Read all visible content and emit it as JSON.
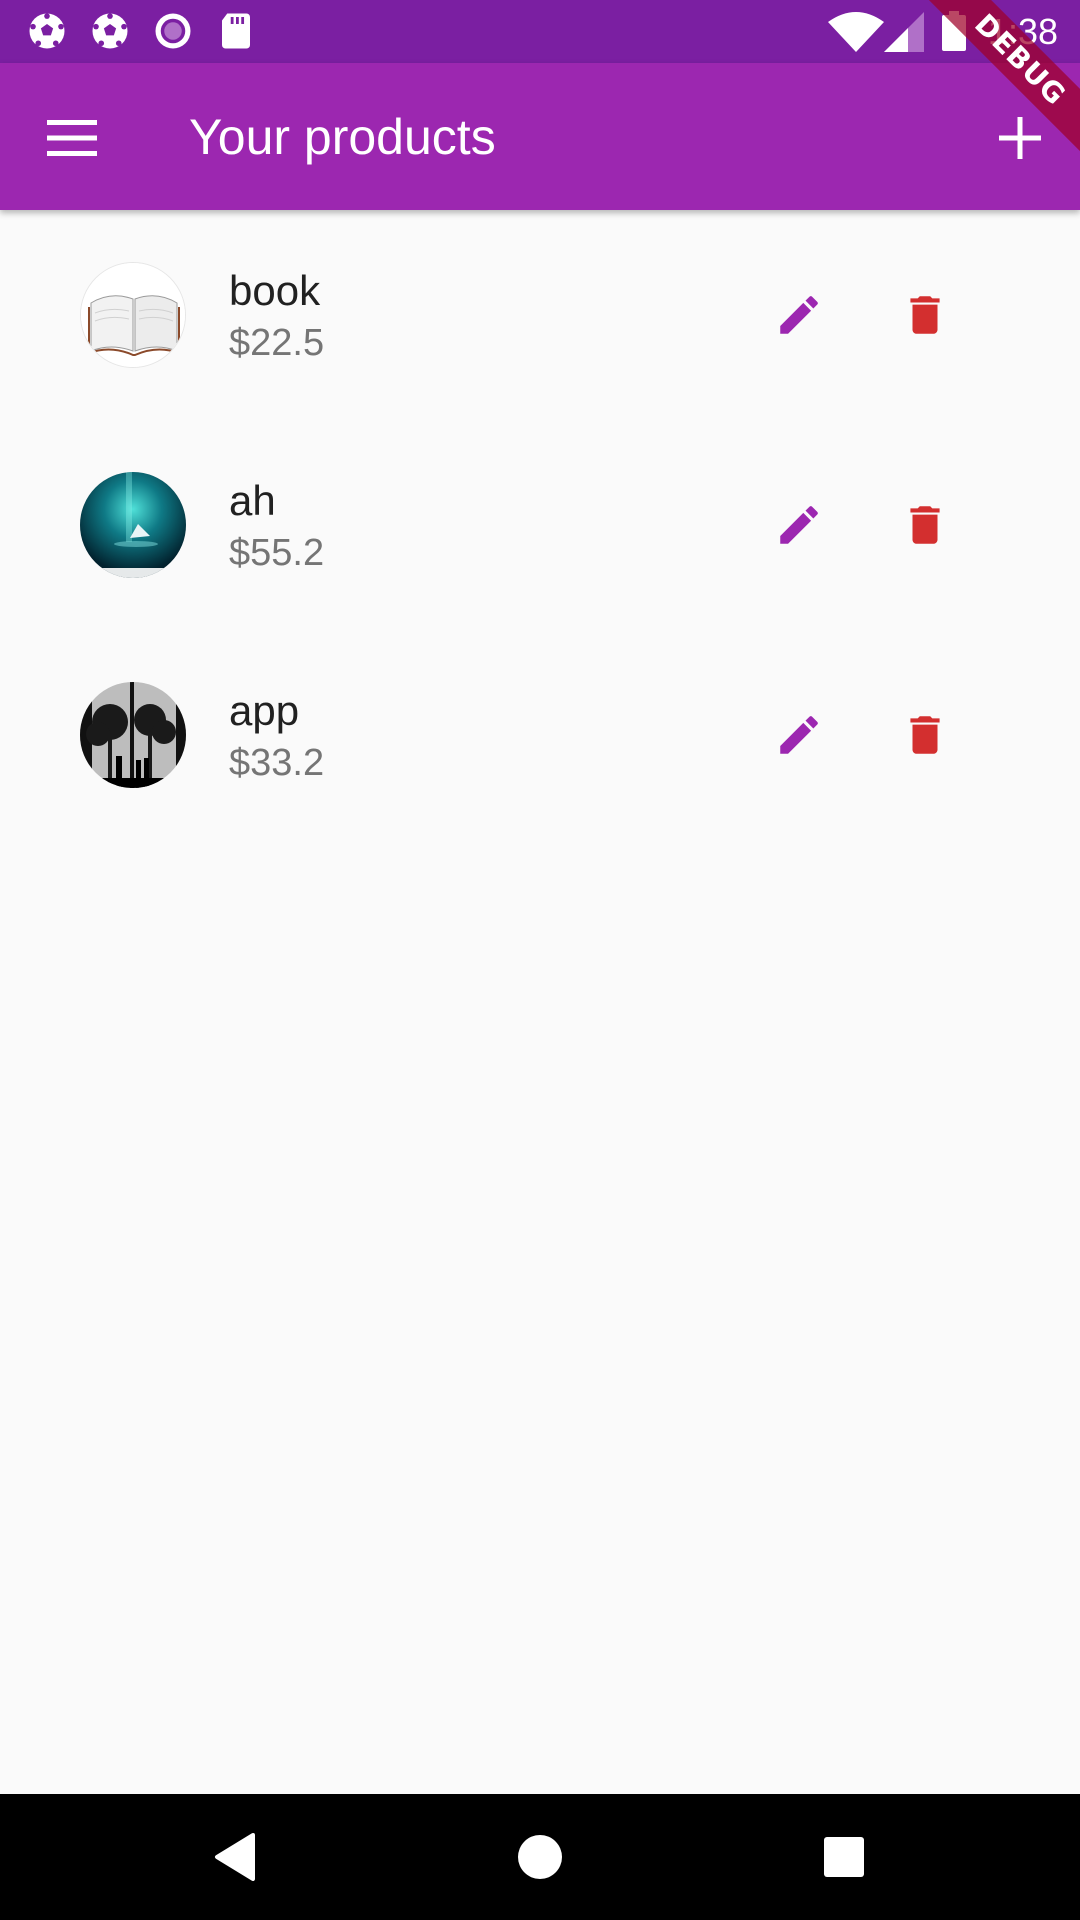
{
  "status_bar": {
    "time": "1:38",
    "notification_icons": [
      "soccer-ball-icon",
      "soccer-ball-icon",
      "record-icon",
      "sd-card-icon"
    ],
    "system_icons": [
      "wifi-icon",
      "cellular-signal-icon",
      "battery-icon"
    ]
  },
  "app_bar": {
    "title": "Your products",
    "menu_icon": "menu-icon",
    "add_icon": "add-icon",
    "color": "#9c27b0"
  },
  "debug_banner": {
    "label": "DEBUG"
  },
  "products": [
    {
      "title": "book",
      "price": "$22.5",
      "image": "open-book-image"
    },
    {
      "title": "ah",
      "price": "$55.2",
      "image": "aurora-boat-image"
    },
    {
      "title": "app",
      "price": "$33.2",
      "image": "tree-silhouette-image"
    }
  ],
  "actions": {
    "edit_icon": "edit-icon",
    "delete_icon": "delete-icon",
    "edit_color": "#9c27b0",
    "delete_color": "#d32f2f"
  },
  "nav_bar": {
    "buttons": [
      "back-icon",
      "home-icon",
      "recents-icon"
    ]
  }
}
